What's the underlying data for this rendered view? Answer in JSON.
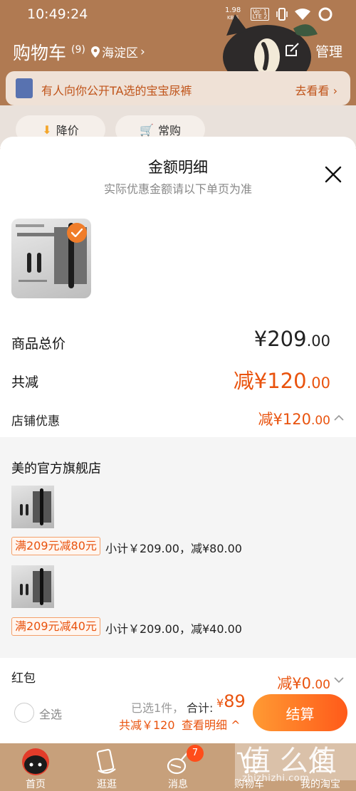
{
  "status_bar": {
    "time": "10:49:24",
    "net_speed": "1.98",
    "net_unit": "KB/S",
    "lte_top": "Vo’ 1",
    "lte_bottom": "LTE 2"
  },
  "cart_header": {
    "title": "购物车",
    "count": "(9)",
    "location": "海淀区",
    "manage": "管理"
  },
  "promo_banner": {
    "text": "有人向你公开TA选的宝宝尿裤",
    "link": "去看看"
  },
  "filters": [
    "降价",
    "常购"
  ],
  "sheet": {
    "title": "金额明细",
    "subtitle": "实际优惠金额请以下单页为准",
    "rows": {
      "total_label": "商品总价",
      "total_int": "¥209",
      "total_dec": ".00",
      "reduce_label": "共减",
      "reduce_int": "减¥120",
      "reduce_dec": ".00",
      "shop_label": "店铺优惠",
      "shop_int": "减¥120",
      "shop_dec": ".00",
      "redpack_label": "红包",
      "redpack_int": "减¥0",
      "redpack_dec": ".00"
    },
    "store": {
      "name": "美的官方旗舰店",
      "items": [
        {
          "coupon": "满209元减80元",
          "subtotal": "小计￥209.00，减¥80.00"
        },
        {
          "coupon": "满209元减40元",
          "subtotal": "小计￥209.00，减¥40.00"
        }
      ]
    }
  },
  "checkout": {
    "select_all": "全选",
    "selected": "已选1件，",
    "total_label": "合计:",
    "total_symbol": "¥",
    "total_value": "89",
    "summary_reduce": "共减￥120",
    "summary_link": "查看明细",
    "button": "结算"
  },
  "bottom_nav": [
    {
      "label": "首页"
    },
    {
      "label": "逛逛"
    },
    {
      "label": "消息",
      "badge": "7"
    },
    {
      "label": "购物车"
    },
    {
      "label": "我的淘宝"
    }
  ],
  "watermark": {
    "text": "值 么值",
    "url": "zhizhizhi.com"
  },
  "colors": {
    "accent": "#e9530e",
    "brand_orange": "#ff5a1a",
    "header_brown": "#b07a52",
    "nav_tan": "#c7a07b"
  }
}
